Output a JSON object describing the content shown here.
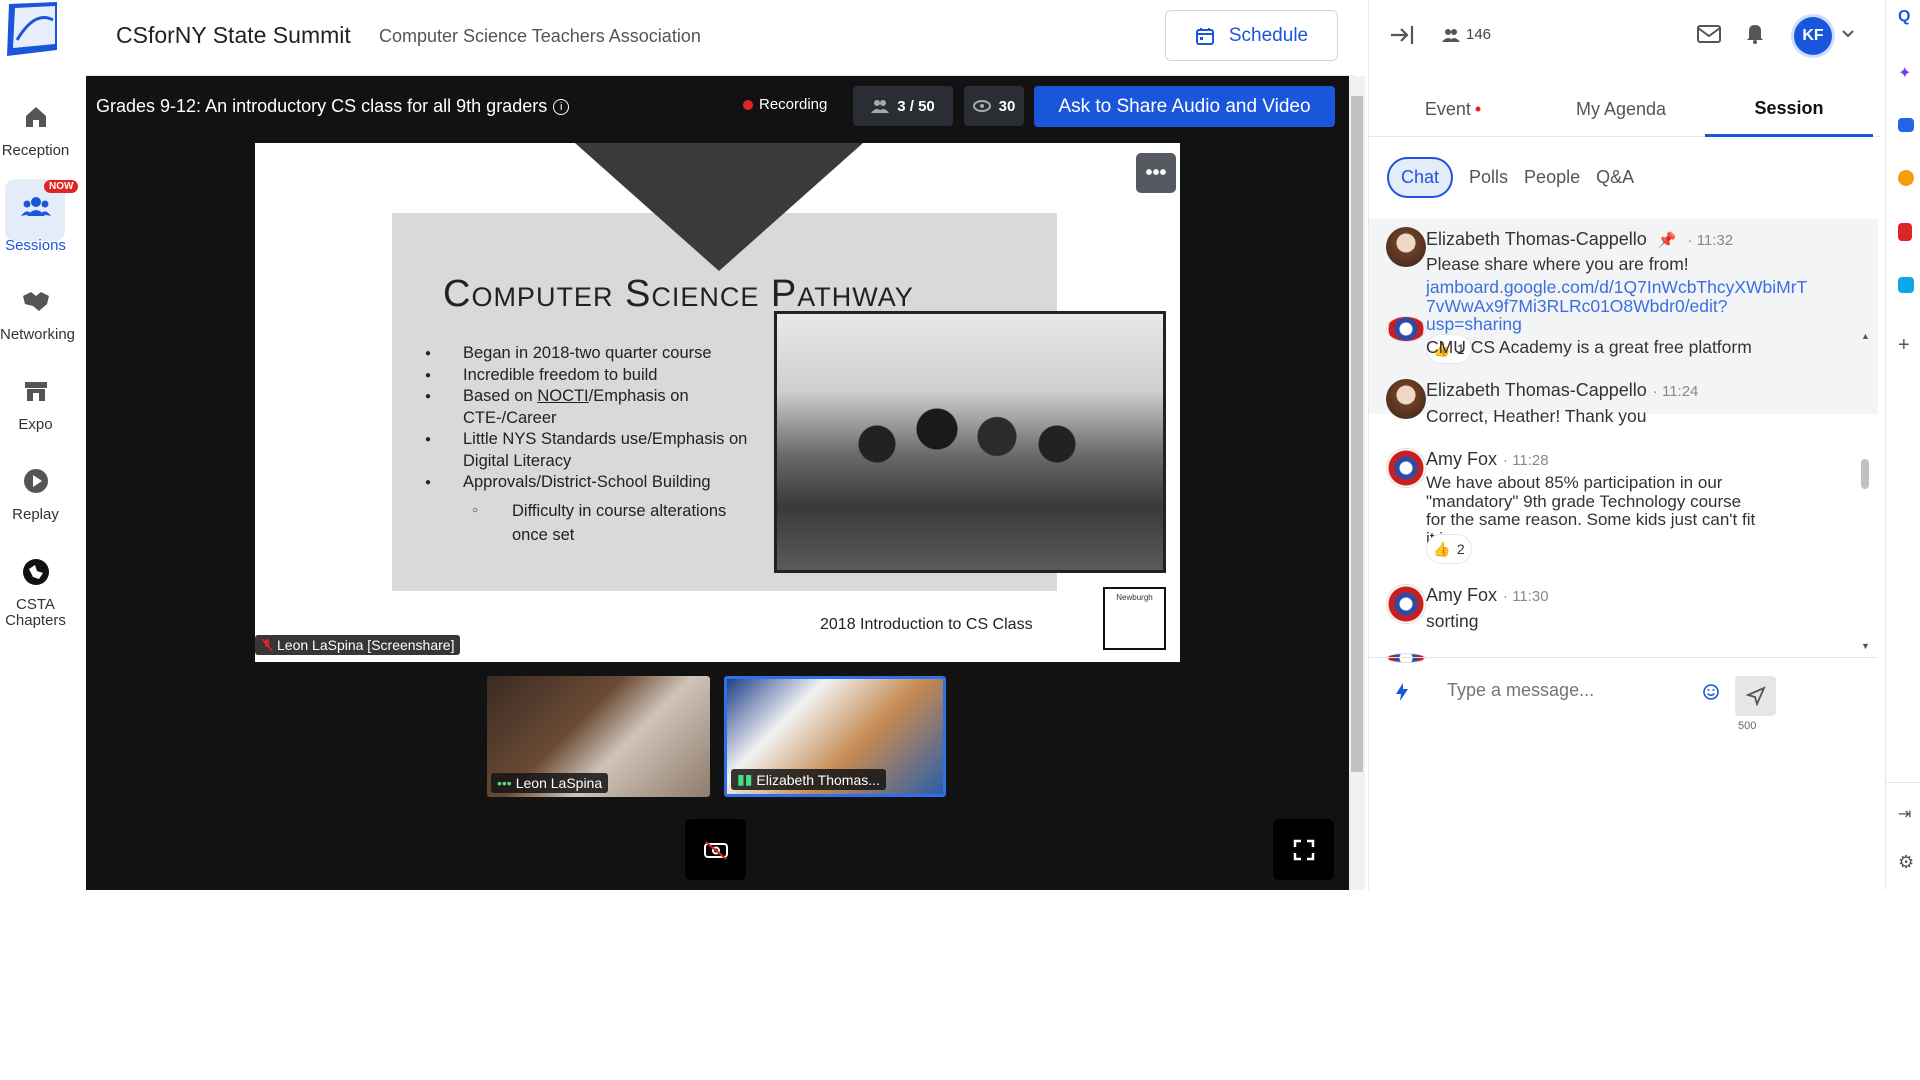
{
  "header": {
    "app_title": "CSforNY State Summit",
    "org_title": "Computer Science Teachers Association",
    "schedule_label": "Schedule"
  },
  "nav": {
    "items": [
      {
        "label": "Reception",
        "icon": "home-icon"
      },
      {
        "label": "Sessions",
        "icon": "people-icon",
        "badge": "NOW",
        "active": true
      },
      {
        "label": "Networking",
        "icon": "handshake-icon"
      },
      {
        "label": "Expo",
        "icon": "store-icon"
      },
      {
        "label": "Replay",
        "icon": "play-icon"
      },
      {
        "label": "CSTA\nChapters",
        "icon": "chapters-icon"
      }
    ],
    "item_label_csta_1": "CSTA",
    "item_label_csta_2": "Chapters"
  },
  "stage": {
    "session_title": "Grades 9-12: An introductory CS class for all 9th graders",
    "recording_label": "Recording",
    "stage_count": "3 / 50",
    "viewer_count": "30",
    "share_button": "Ask to Share Audio and Video",
    "screenshare_name": "Leon LaSpina [Screenshare]",
    "participants": [
      {
        "name": "Leon LaSpina"
      },
      {
        "name": "Elizabeth Thomas..."
      }
    ]
  },
  "slide": {
    "heading": "Computer Science Pathway",
    "bullets": [
      "Began in 2018-two quarter course",
      "Incredible freedom to build",
      "Based on NOCTI/Emphasis on CTE-/Career",
      "Little NYS Standards use/Emphasis on Digital Literacy",
      "Approvals/District-School Building"
    ],
    "bullet3_prefix": "Based on ",
    "bullet3_link": "NOCTI",
    "bullet3_suffix": "/Emphasis on CTE-/Career",
    "sub_bullet": "Difficulty in course alterations once set",
    "caption": "2018 Introduction to CS Class",
    "logo_text": "Newburgh"
  },
  "panel": {
    "attendee_count": "146",
    "user_initials": "KF",
    "tabs": [
      {
        "label": "Event"
      },
      {
        "label": "My Agenda"
      },
      {
        "label": "Session",
        "active": true
      }
    ],
    "subtabs": [
      "Chat",
      "Polls",
      "People",
      "Q&A"
    ],
    "pinned": {
      "name": "Elizabeth Thomas-Cappello",
      "time": "11:32",
      "text": "Please share where you are from!",
      "link": "jamboard.google.com/d/1Q7InWcbThcyXWbiMrT7vWwAx9f7Mi3RLRc01O8Wbdr0/edit?usp=sharing",
      "link_line1": "jamboard.google.com/d/1Q7InWcbThcyXWbiMrT",
      "link_line2": "7vWwAx9f7Mi3RLRc01O8Wbdr0/edit?",
      "link_line3": "usp=sharing",
      "reactions": "1"
    },
    "messages": [
      {
        "name": "",
        "time": "",
        "text": "CMU CS Academy is a great free platform"
      },
      {
        "name": "Elizabeth Thomas-Cappello",
        "time": "11:24",
        "text": "Correct, Heather! Thank you"
      },
      {
        "name": "Amy Fox",
        "time": "11:28",
        "text": "We have about 85% participation in our \"mandatory\" 9th grade Technology course for the same reason. Some kids just can't fit it in.",
        "reactions": "2"
      },
      {
        "name": "Amy Fox",
        "time": "11:30",
        "text": "sorting"
      }
    ],
    "composer_placeholder": "Type a message...",
    "char_count": "500"
  },
  "colors": {
    "accent": "#1a56db",
    "stage_bg": "#121212",
    "recording": "#e02424"
  }
}
